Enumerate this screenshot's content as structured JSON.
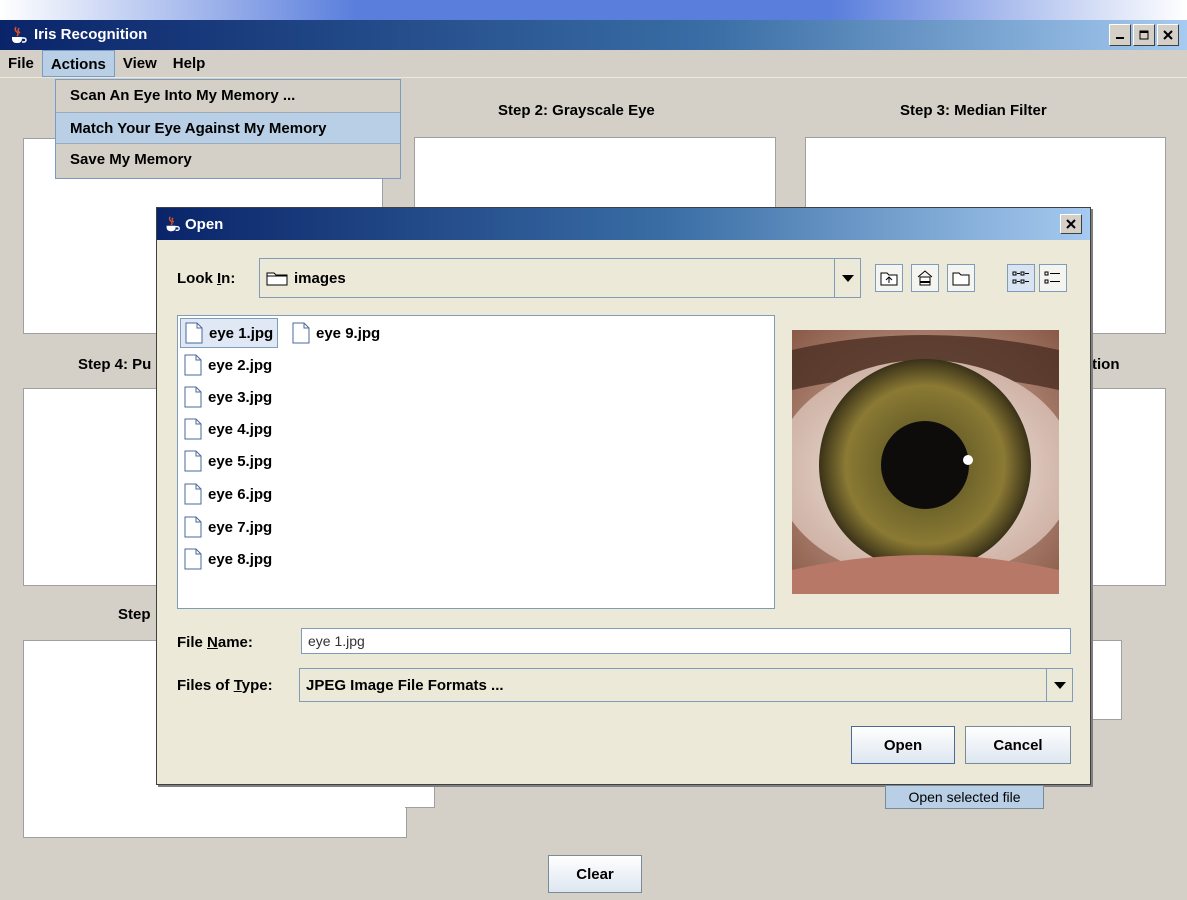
{
  "window": {
    "title": "Iris Recognition"
  },
  "menubar": {
    "items": [
      "File",
      "Actions",
      "View",
      "Help"
    ],
    "active": "Actions"
  },
  "actions_menu": {
    "items": [
      "Scan An Eye Into My Memory ...",
      "Match Your Eye Against My Memory",
      "Save My Memory"
    ],
    "highlighted": "Match Your Eye Against My Memory"
  },
  "steps": {
    "step2": "Step 2: Grayscale Eye",
    "step3": "Step 3: Median Filter",
    "step4_partial": "Step 4: Pu",
    "step6_partial": "tion",
    "step7_partial": "Step"
  },
  "clear_button": "Clear",
  "dialog": {
    "title": "Open",
    "look_in_label_pre": "Look ",
    "look_in_label_mn": "I",
    "look_in_label_post": "n:",
    "look_in_value": "images",
    "files": [
      "eye 1.jpg",
      "eye 2.jpg",
      "eye 3.jpg",
      "eye 4.jpg",
      "eye 5.jpg",
      "eye 6.jpg",
      "eye 7.jpg",
      "eye 8.jpg",
      "eye 9.jpg"
    ],
    "selected_file": "eye 1.jpg",
    "file_name_label_pre": "File ",
    "file_name_label_mn": "N",
    "file_name_label_post": "ame:",
    "file_name_value": "eye 1.jpg",
    "files_of_type_label_pre": "Files of ",
    "files_of_type_label_mn": "T",
    "files_of_type_label_post": "ype:",
    "files_of_type_value": "JPEG Image File Formats ...",
    "open_button": "Open",
    "cancel_button": "Cancel"
  },
  "tooltip": "Open selected file",
  "icons": {
    "app": "java-cup-icon",
    "toolbar": [
      "up-one-level-icon",
      "home-icon",
      "new-folder-icon",
      "list-view-icon",
      "details-view-icon"
    ]
  },
  "colors": {
    "title_bar_start": "#0a246a",
    "title_bar_end": "#a6caf0",
    "highlight": "#b8cfe5",
    "window_bg": "#d4d0c8",
    "dialog_bg": "#ece9d8"
  }
}
